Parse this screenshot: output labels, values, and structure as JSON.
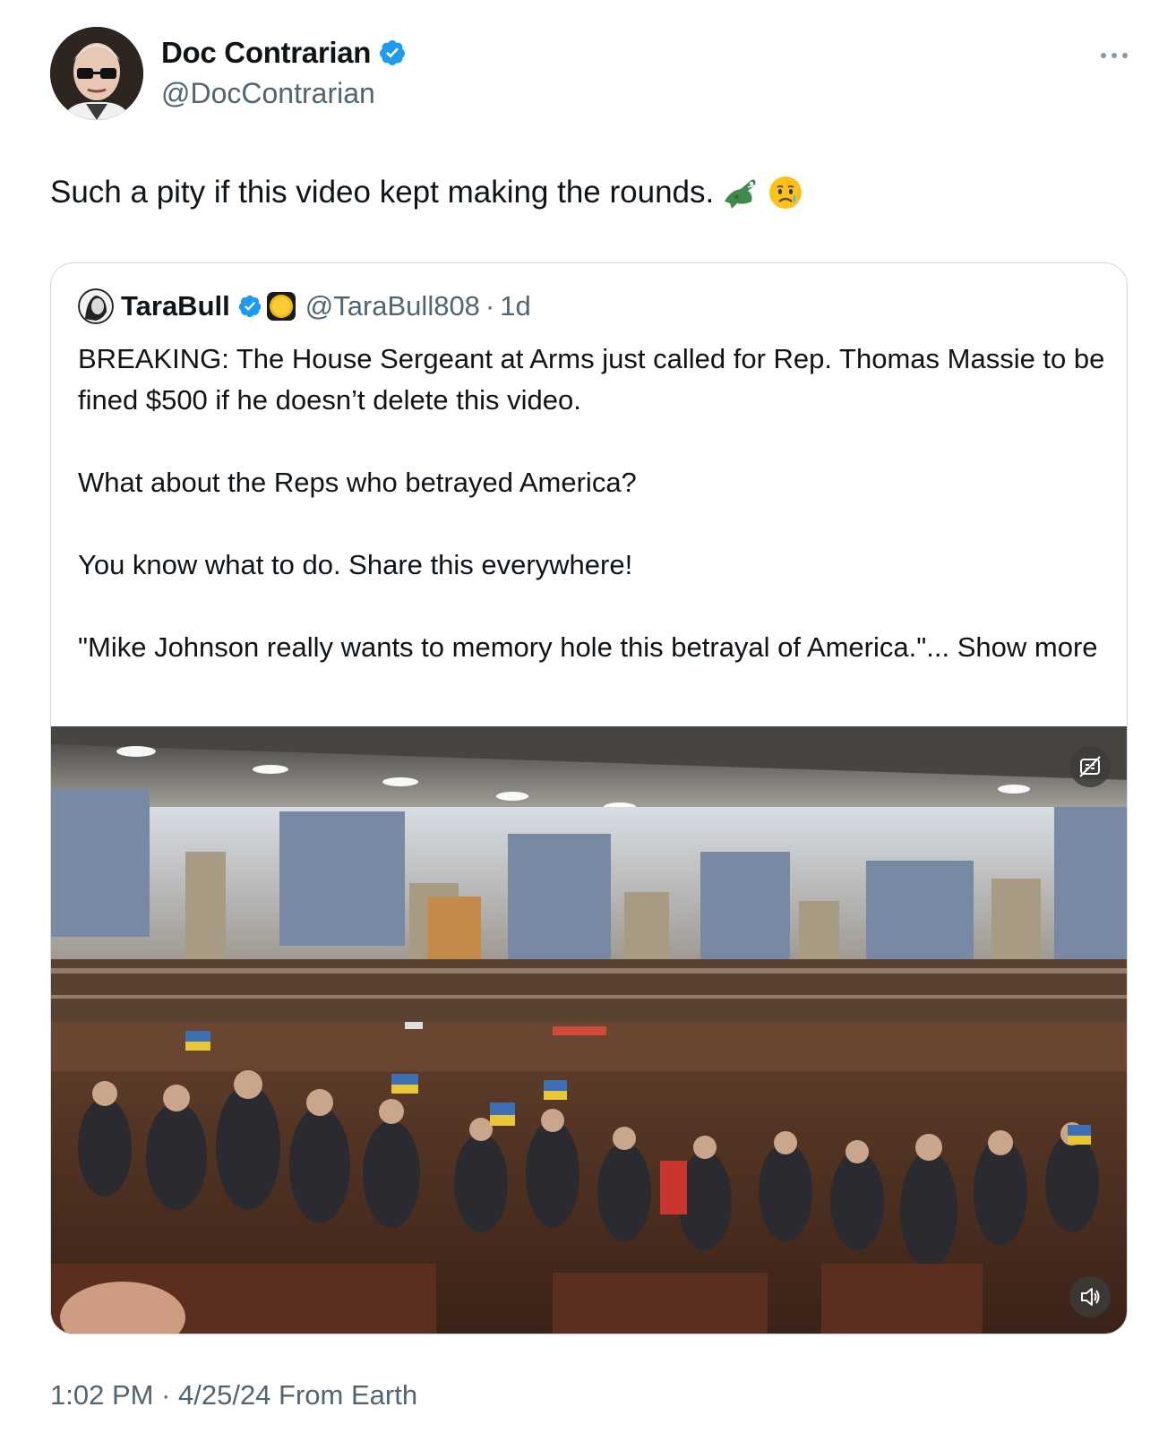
{
  "author": {
    "display_name": "Doc Contrarian",
    "handle": "@DocContrarian",
    "verified": true
  },
  "tweet": {
    "text": "Such a pity if this video kept making the rounds.",
    "emojis": [
      "crocodile-emoji",
      "sad-relieved-face-emoji"
    ]
  },
  "quoted": {
    "display_name": "TaraBull",
    "handle": "@TaraBull808",
    "separator": "·",
    "time": "1d",
    "verified": true,
    "paragraphs": [
      "BREAKING: The House Sergeant at Arms just called for Rep. Thomas Massie to be fined $500 if he doesn’t delete this video.",
      "What about the Reps who betrayed America?",
      "You know what to do. Share this everywhere!",
      "\"Mike Johnson really wants to memory hole this betrayal of America.\"..."
    ],
    "show_more": "Show more",
    "media": {
      "type": "video",
      "controls": [
        "captions-icon",
        "volume-icon"
      ]
    }
  },
  "footer": {
    "timestamp": "1:02 PM · 4/25/24 From Earth"
  },
  "colors": {
    "verified_blue": "#1d9bf0",
    "secondary_text": "#536471",
    "border": "#cfd9de"
  }
}
